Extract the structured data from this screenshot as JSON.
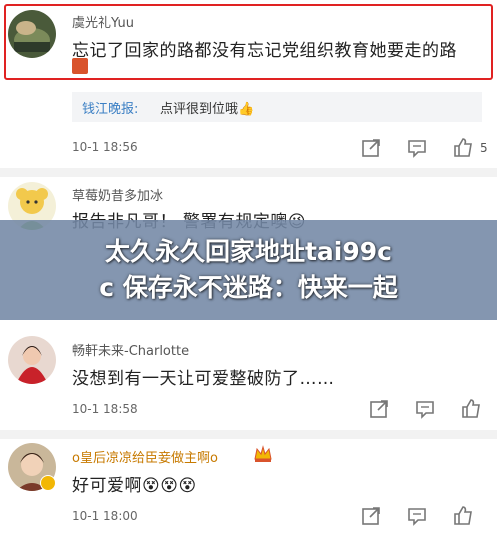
{
  "comments": [
    {
      "username": "虞光礼Yuu",
      "text": "忘记了回家的路都没有忘记党组织教育她要走的路",
      "highlighted": true,
      "reply": {
        "name": "钱江晚报:",
        "text": "点评很到位哦👍"
      },
      "timestamp": "10-1 18:56",
      "likes": "5"
    },
    {
      "username": "草莓奶昔多加冰",
      "text": "报告非凡哥！ 警署有规定噢😉",
      "timestamp": "",
      "likes": ""
    },
    {
      "username": "畅軒未来-Charlotte",
      "text": "没想到有一天让可爱整破防了……",
      "timestamp": "10-1 18:58",
      "likes": ""
    },
    {
      "username": "o皇后凉凉给臣妾做主啊o",
      "text": "好可爱啊😵😵😵",
      "timestamp": "10-1 18:00",
      "likes": ""
    }
  ],
  "banner": {
    "line1": "太久永久回家地址tai99c",
    "line2": "c 保存永不迷路：快来一起"
  },
  "colors": {
    "highlight_border": "#e02222",
    "reply_name": "#3b7fc4",
    "banner_bg": "#7387a5"
  },
  "icons": [
    "share-icon",
    "comment-icon",
    "like-icon",
    "crown-badge-icon"
  ]
}
